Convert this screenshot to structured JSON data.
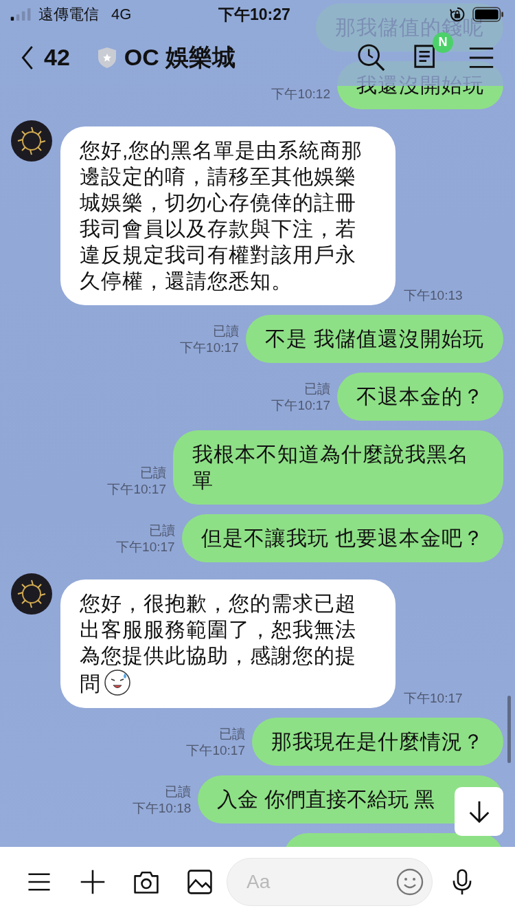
{
  "status_bar": {
    "carrier": "遠傳電信",
    "network": "4G",
    "time": "下午10:27"
  },
  "header": {
    "back_count": "42",
    "title": "OC 娛樂城",
    "notes_badge": "N"
  },
  "messages": [
    {
      "kind": "sent",
      "text": "那我儲值的錢呢"
    },
    {
      "kind": "sent",
      "text": "我還沒開始玩",
      "time": "下午10:12"
    },
    {
      "kind": "received",
      "text": "您好,您的黑名單是由系統商那邊設定的唷，請移至其他娛樂城娛樂，切勿心存僥倖的註冊我司會員以及存款與下注，若違反規定我司有權對該用戶永久停權，還請您悉知。",
      "time": "下午10:13",
      "emoji": false
    },
    {
      "kind": "sent",
      "text": "不是 我儲值還沒開始玩",
      "read": "已讀",
      "time": "下午10:17"
    },
    {
      "kind": "sent",
      "text": "不退本金的？",
      "read": "已讀",
      "time": "下午10:17"
    },
    {
      "kind": "sent",
      "text": "我根本不知道為什麼說我黑名單",
      "read": "已讀",
      "time": "下午10:17"
    },
    {
      "kind": "sent",
      "text": "但是不讓我玩 也要退本金吧？",
      "read": "已讀",
      "time": "下午10:17"
    },
    {
      "kind": "received",
      "text": "您好，很抱歉，您的需求已超出客服服務範圍了，恕我無法為您提供此協助，感謝您的提問",
      "time": "下午10:17",
      "emoji": true
    },
    {
      "kind": "sent",
      "text": "那我現在是什麼情況？",
      "read": "已讀",
      "time": "下午10:17"
    },
    {
      "kind": "sent-covered",
      "text": "入金 你們直接不給玩 黑",
      "read": "已讀",
      "time": "下午10:18"
    },
    {
      "kind": "sent-cut"
    }
  ],
  "composer": {
    "placeholder": "Aa"
  }
}
